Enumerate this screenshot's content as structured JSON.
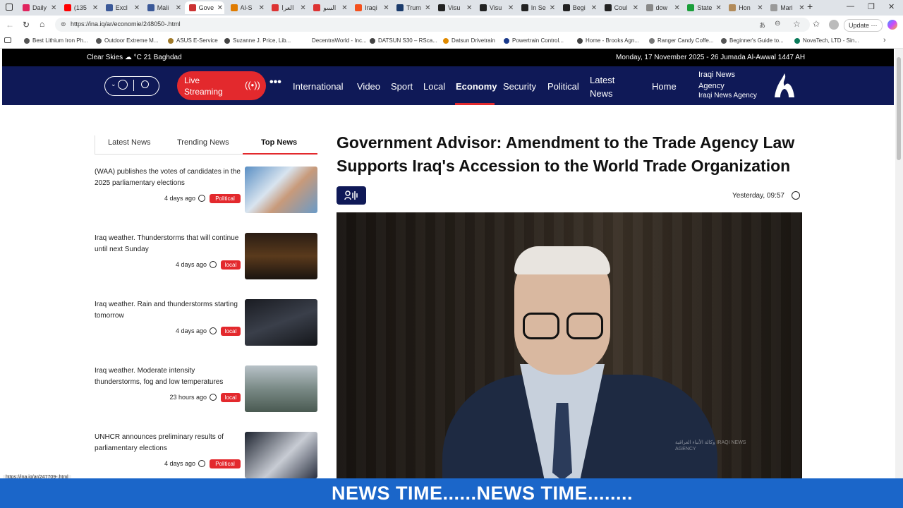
{
  "browser": {
    "tabs": [
      {
        "title": "Daily",
        "color": "#e0245e"
      },
      {
        "title": "(135",
        "color": "#ff0000"
      },
      {
        "title": "Excl",
        "color": "#3b5998"
      },
      {
        "title": "Mali",
        "color": "#3b5998"
      },
      {
        "title": "Gove",
        "color": "#c33",
        "active": true
      },
      {
        "title": "Al-S",
        "color": "#e07b00"
      },
      {
        "title": "العرا",
        "color": "#d33"
      },
      {
        "title": "السو",
        "color": "#d33"
      },
      {
        "title": "Iraqi",
        "color": "#f4511e"
      },
      {
        "title": "Trum",
        "color": "#1a3a6b"
      },
      {
        "title": "Visu",
        "color": "#222"
      },
      {
        "title": "Visu",
        "color": "#222"
      },
      {
        "title": "In Se",
        "color": "#222"
      },
      {
        "title": "Begi",
        "color": "#222"
      },
      {
        "title": "Coul",
        "color": "#222"
      },
      {
        "title": "dow",
        "color": "#888"
      },
      {
        "title": "State",
        "color": "#1a9e3a"
      },
      {
        "title": "Hon",
        "color": "#b28b5a"
      },
      {
        "title": "Mari",
        "color": "#999"
      }
    ],
    "url": "https://ina.iq/ar/economie/248050-.html",
    "update_label": "Update",
    "bookmarks": [
      "Best Lithium Iron Ph...",
      "Outdoor Extreme M...",
      "ASUS E-Service",
      "Suzanne J. Price, Lib...",
      "DecentraWorld - Inc...",
      "DATSUN S30 – RSca...",
      "Datsun Drivetrain",
      "Powertrain Control...",
      "Home - Brooks Agn...",
      "Ranger Candy Coffe...",
      "Beginner's Guide to...",
      "NovaTech, LTD - Sin..."
    ],
    "status_url": "https://ina.iq/ar/247709-.html"
  },
  "site": {
    "weather": "Clear Skies  ☁ °C 21 Baghdad",
    "date": "Monday, 17 November 2025 - 26 Jumada Al-Awwal 1447 AH",
    "live_label": "Live Streaming",
    "nav": [
      "International",
      "Video",
      "Sport",
      "Local",
      "Economy",
      "Security",
      "Political",
      "Latest News",
      "Home"
    ],
    "active_nav": "Economy",
    "brand_en": "Iraqi News Agency",
    "brand_sub": "Iraqi News Agency"
  },
  "sidebar": {
    "tabs": [
      "Latest News",
      "Trending News",
      "Top News"
    ],
    "active_tab": "Top News",
    "items": [
      {
        "title": "(WAA) publishes the votes of candidates in the 2025 parliamentary elections",
        "time": "4 days ago",
        "tag": "Political"
      },
      {
        "title": "Iraq weather. Thunderstorms that will continue until next Sunday",
        "time": "4 days ago",
        "tag": "local"
      },
      {
        "title": "Iraq weather. Rain and thunderstorms starting tomorrow",
        "time": "4 days ago",
        "tag": "local"
      },
      {
        "title": "Iraq weather. Moderate intensity thunderstorms, fog and low temperatures",
        "time": "23 hours ago",
        "tag": "local"
      },
      {
        "title": "UNHCR announces preliminary results of parliamentary elections",
        "time": "4 days ago",
        "tag": "Political"
      }
    ]
  },
  "article": {
    "headline": "Government Advisor: Amendment to the Trade Agency Law Supports Iraq's Accession to the World Trade Organization",
    "timestamp": "Yesterday, 09:57",
    "watermark": "وكالة الأنباء العراقية IRAQI NEWS AGENCY"
  },
  "ticker": {
    "text": "NEWS TIME......NEWS TIME........"
  },
  "colors": {
    "nav_bg": "#0f1957",
    "accent_red": "#e3292d",
    "ticker_bg": "#1b66c9"
  }
}
